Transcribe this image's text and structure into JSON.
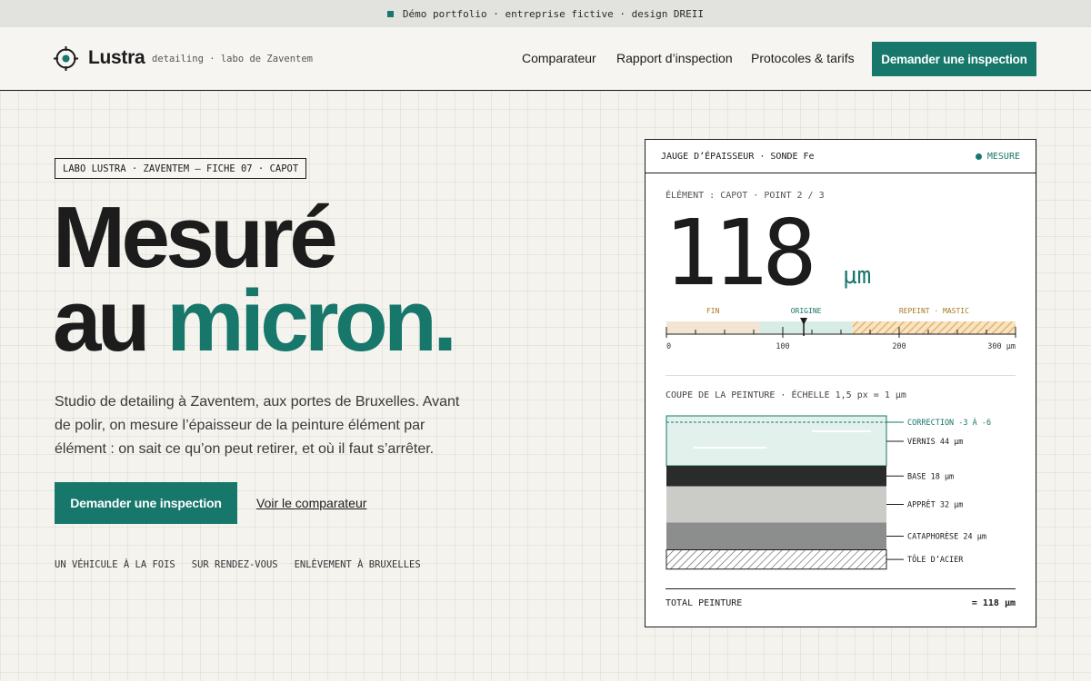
{
  "topbar": {
    "text": "Démo portfolio · entreprise fictive · design DREII"
  },
  "header": {
    "brand": "Lustra",
    "tagline": "detailing · labo de Zaventem",
    "nav": [
      "Comparateur",
      "Rapport d’inspection",
      "Protocoles & tarifs"
    ],
    "cta": "Demander une inspection"
  },
  "hero": {
    "fiche": "LABO LUSTRA · ZAVENTEM — FICHE 07 · CAPOT",
    "title_line1": "Mesuré",
    "title_line2_a": "au",
    "title_line2_b": "micron.",
    "lead": "Studio de detailing à Zaventem, aux portes de Bruxelles. Avant de polir, on mesure l’épaisseur de la peinture élément par élément : on sait ce qu’on peut retirer, et où il faut s’arrêter.",
    "primary_cta": "Demander une inspection",
    "secondary_cta": "Voir le comparateur",
    "features": [
      "UN VÉHICULE À LA FOIS",
      "SUR RENDEZ-VOUS",
      "ENLÈVEMENT À BRUXELLES"
    ]
  },
  "gauge": {
    "title": "JAUGE D’ÉPAISSEUR · SONDE Fe",
    "status": "MESURE",
    "element_label": "ÉLÉMENT : CAPOT · POINT 2 / 3",
    "value": "118",
    "unit": "µm",
    "value_num": 118,
    "scale_max": 300,
    "zones": [
      {
        "label": "FIN",
        "from": 0,
        "to": 80,
        "color": "#f2e6d2",
        "label_color": "#a77a1f"
      },
      {
        "label": "ORIGINE",
        "from": 80,
        "to": 160,
        "color": "#d8ece6",
        "label_color": "#17776b"
      },
      {
        "label": "REPEINT · MASTIC",
        "from": 160,
        "to": 300,
        "color": "#f0d3a5",
        "label_color": "#a77a1f"
      }
    ],
    "ticks": [
      {
        "value": 0,
        "label": "0"
      },
      {
        "value": 100,
        "label": "100"
      },
      {
        "value": 200,
        "label": "200"
      },
      {
        "value": 300,
        "label": "300 µm"
      }
    ],
    "coupe_label": "COUPE DE LA PEINTURE · ÉCHELLE 1,5 px = 1 µm",
    "correction": "CORRECTION -3 À -6",
    "layers": [
      {
        "label": "VERNIS 44 µm",
        "thickness": 44,
        "color": "#e3f1ec",
        "kind": "clear"
      },
      {
        "label": "BASE 18 µm",
        "thickness": 18,
        "color": "#2a2c2b",
        "kind": "solid"
      },
      {
        "label": "APPRÊT 32 µm",
        "thickness": 32,
        "color": "#cbcbc7",
        "kind": "solid"
      },
      {
        "label": "CATAPHORÈSE 24 µm",
        "thickness": 24,
        "color": "#8c8e8d",
        "kind": "solid"
      },
      {
        "label": "TÔLE D’ACIER",
        "thickness": 17,
        "color": "#ffffff",
        "kind": "hatch"
      }
    ],
    "total_label": "TOTAL PEINTURE",
    "total_value": "= 118 µm"
  },
  "colors": {
    "accent": "#17776b",
    "ink": "#1c1c1c",
    "paper": "#f4f3ee"
  }
}
